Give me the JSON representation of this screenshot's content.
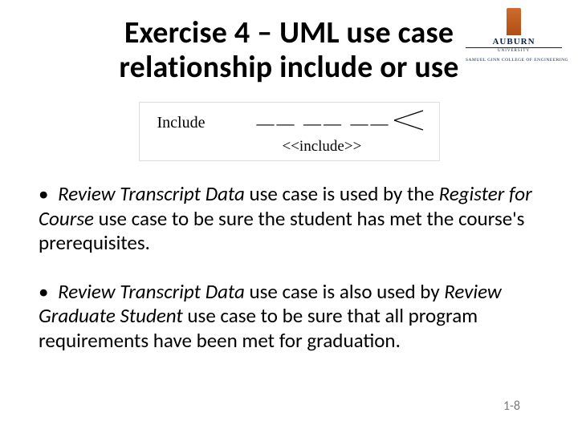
{
  "logo": {
    "name": "AUBURN",
    "subname": "UNIVERSITY",
    "college": "SAMUEL GINN COLLEGE OF ENGINEERING"
  },
  "title": "Exercise 4 – UML use case relationship include or use",
  "uml_figure": {
    "include_label": "Include",
    "stereotype": "<<include>>"
  },
  "bullets": [
    {
      "dot": "•",
      "italic1": "Review Transcript Data",
      "plain1": " use case is used by the ",
      "italic2": "Register for Course",
      "plain2": " use case to be sure the student has met the course's prerequisites."
    },
    {
      "dot": "•",
      "italic1": "Review Transcript Data",
      "plain1": " use case is also used by ",
      "italic2": "Review Graduate Student",
      "plain2": " use case to be sure that all program  requirements have been met for graduation."
    }
  ],
  "page_number": "1-8"
}
